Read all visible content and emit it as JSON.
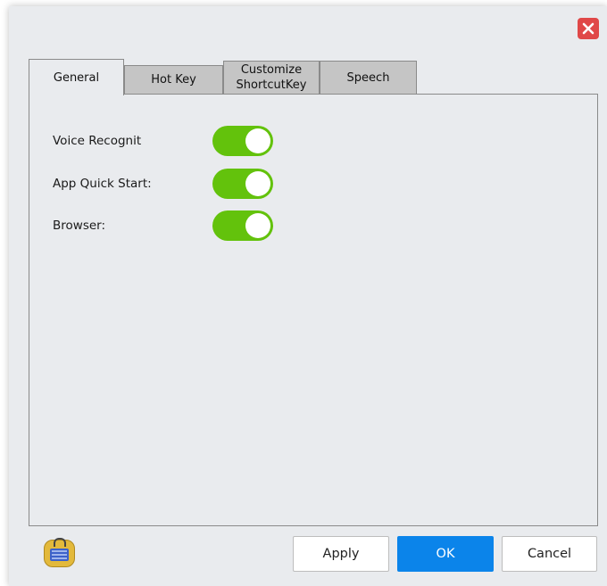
{
  "dialog": {
    "close_icon": "close-icon",
    "accent_color": "#63c20c",
    "close_color": "#e04848"
  },
  "tabs": [
    {
      "label": "General",
      "active": true
    },
    {
      "label": "Hot Key",
      "active": false
    },
    {
      "label": "Customize\nShortcutKey",
      "active": false
    },
    {
      "label": "Speech",
      "active": false
    }
  ],
  "general": {
    "settings": [
      {
        "label": "Voice Recognit",
        "enabled": true
      },
      {
        "label": "App Quick Start:",
        "enabled": true
      },
      {
        "label": "Browser:",
        "enabled": true
      }
    ]
  },
  "footer": {
    "icon": "keyboard-icon",
    "apply_label": "Apply",
    "ok_label": "OK",
    "cancel_label": "Cancel",
    "primary_color": "#0b84ea"
  }
}
